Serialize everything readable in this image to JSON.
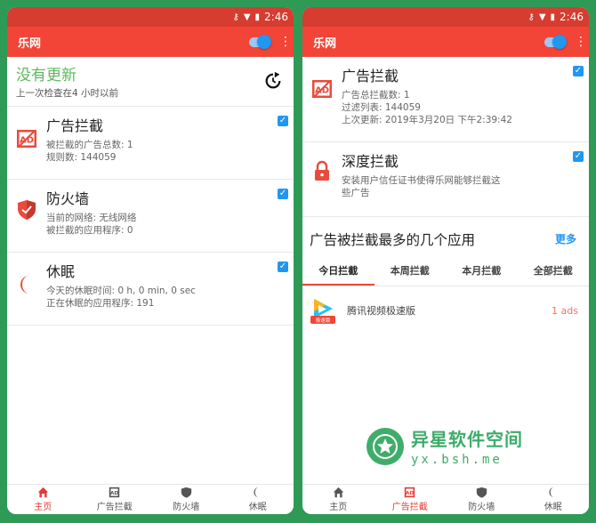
{
  "left": {
    "status": {
      "time": "2:46"
    },
    "appbar": {
      "title": "乐网"
    },
    "update": {
      "title": "没有更新",
      "subtitle": "上一次检查在4 小时以前"
    },
    "cards": [
      {
        "title": "广告拦截",
        "lines": [
          "被拦截的广告总数: 1",
          "规则数: 144059"
        ],
        "checked": true
      },
      {
        "title": "防火墙",
        "lines": [
          "当前的网络: 无线网络",
          "被拦截的应用程序: 0"
        ],
        "checked": true
      },
      {
        "title": "休眠",
        "lines": [
          "今天的休眠时间: 0 h, 0 min, 0 sec",
          "正在休眠的应用程序: 191"
        ],
        "checked": true
      }
    ],
    "nav": [
      "主页",
      "广告拦截",
      "防火墙",
      "休眠"
    ],
    "nav_active": 0
  },
  "right": {
    "status": {
      "time": "2:46"
    },
    "appbar": {
      "title": "乐网"
    },
    "cards": [
      {
        "title": "广告拦截",
        "lines": [
          "广告总拦截数: 1",
          "过滤列表: 144059",
          "上次更新: 2019年3月20日 下午2:39:42"
        ],
        "checked": true
      },
      {
        "title": "深度拦截",
        "lines": [
          "安装用户信任证书使得乐网能够拦截这",
          "些广告"
        ],
        "checked": true
      }
    ],
    "top_apps": {
      "title": "广告被拦截最多的几个应用",
      "more_label": "更多",
      "tabs": [
        "今日拦截",
        "本周拦截",
        "本月拦截",
        "全部拦截"
      ],
      "active_tab": 0,
      "apps": [
        {
          "name": "腾讯视频极速版",
          "ads": "1 ads",
          "badge": "极速版"
        }
      ]
    },
    "watermark": {
      "title": "异星软件空间",
      "url": "yx.bsh.me"
    },
    "nav": [
      "主页",
      "广告拦截",
      "防火墙",
      "休眠"
    ],
    "nav_active": 1
  },
  "colors": {
    "primary": "#f24537",
    "status_bar": "#d63c2f",
    "accent": "#2196f3",
    "update_ok": "#5cb85c",
    "background": "#2e9a56"
  }
}
